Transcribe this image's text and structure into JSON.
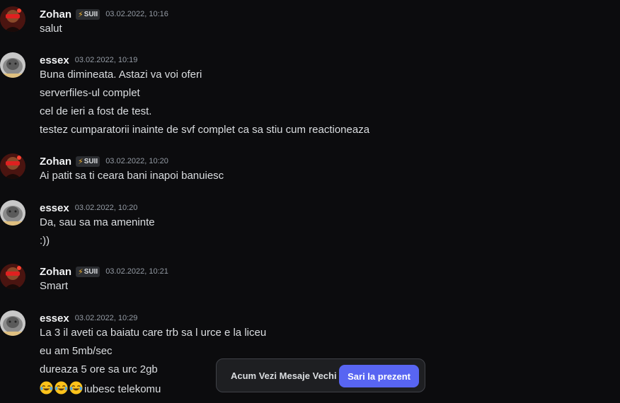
{
  "messages": [
    {
      "user": "Zohan",
      "tag": "SUII",
      "tag_icon": "lightning-bolt",
      "time": "03.02.2022, 10:16",
      "lines": [
        "salut"
      ]
    },
    {
      "user": "essex",
      "time": "03.02.2022, 10:19",
      "lines": [
        "Buna dimineata. Astazi va voi oferi",
        "serverfiles-ul complet",
        "cel de ieri a fost de test.",
        "testez cumparatorii inainte de svf complet ca sa stiu cum reactioneaza"
      ]
    },
    {
      "user": "Zohan",
      "tag": "SUII",
      "tag_icon": "lightning-bolt",
      "time": "03.02.2022, 10:20",
      "lines": [
        "Ai patit sa ti ceara bani inapoi banuiesc"
      ]
    },
    {
      "user": "essex",
      "time": "03.02.2022, 10:20",
      "lines": [
        "Da, sau sa ma ameninte",
        ":))"
      ]
    },
    {
      "user": "Zohan",
      "tag": "SUII",
      "tag_icon": "lightning-bolt",
      "time": "03.02.2022, 10:21",
      "lines": [
        "Smart"
      ]
    },
    {
      "user": "essex",
      "time": "03.02.2022, 10:29",
      "lines": [
        "La 3 il aveti ca baiatu care trb sa l urce e la liceu",
        "eu am 5mb/sec",
        "dureaza 5 ore sa urc 2gb",
        "iubesc telekomu"
      ],
      "emoji_line_icons": [
        "joy-emoji",
        "joy-emoji",
        "joy-emoji"
      ]
    }
  ],
  "jump_bar": {
    "label": "Acum Vezi Mesaje Vechi",
    "button": "Sari la prezent"
  },
  "colors": {
    "background": "#0c0c0e",
    "username": "#f2f3f5",
    "timestamp": "#949ba4",
    "accent_button": "#5865f2",
    "tag_bolt": "#f0b232"
  }
}
